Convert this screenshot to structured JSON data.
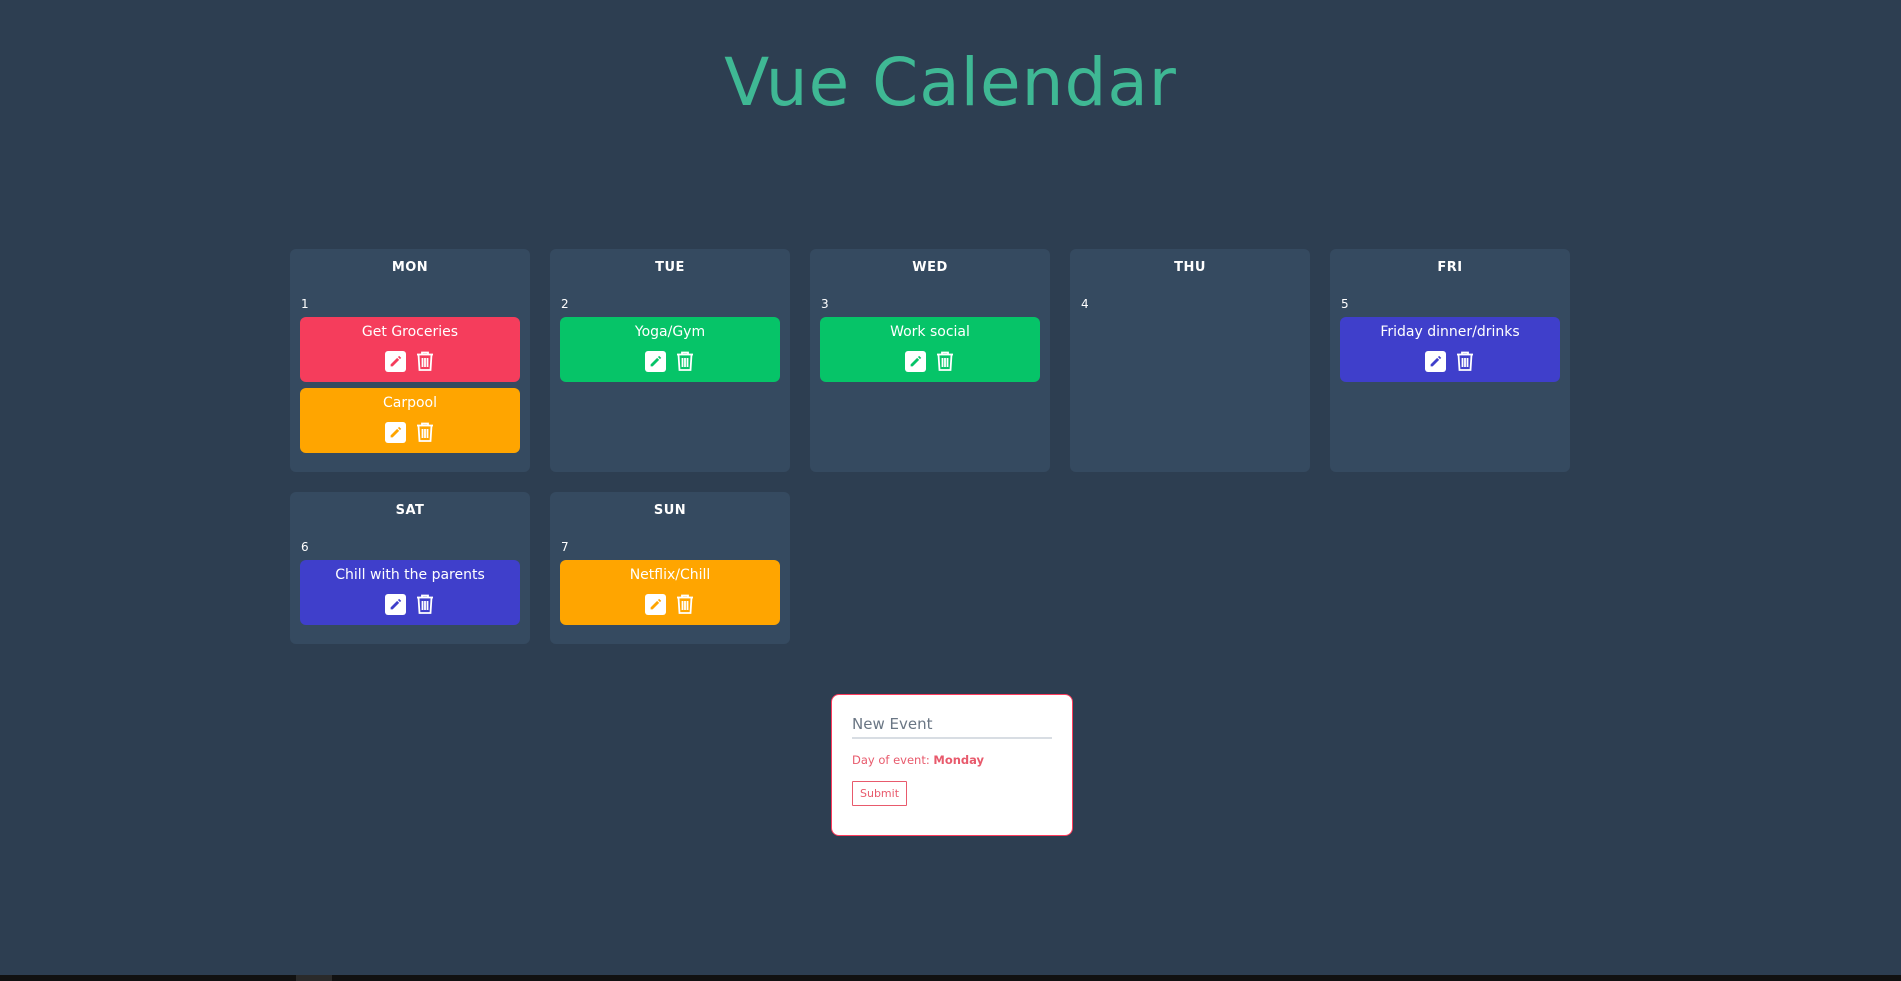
{
  "app": {
    "title": "Vue Calendar"
  },
  "colors": {
    "background": "#2d3e51",
    "card": "#354a60",
    "title": "#3fb894",
    "red": "#f53d5c",
    "orange": "#ffa500",
    "green": "#06c468",
    "blue": "#3f3fcb",
    "formAccent": "#e85a6c"
  },
  "days": [
    {
      "name": "MON",
      "number": "1",
      "events": [
        {
          "title": "Get Groceries",
          "color": "#f53d5c"
        },
        {
          "title": "Carpool",
          "color": "#ffa500"
        }
      ]
    },
    {
      "name": "TUE",
      "number": "2",
      "events": [
        {
          "title": "Yoga/Gym",
          "color": "#06c468"
        }
      ]
    },
    {
      "name": "WED",
      "number": "3",
      "events": [
        {
          "title": "Work social",
          "color": "#06c468"
        }
      ]
    },
    {
      "name": "THU",
      "number": "4",
      "events": []
    },
    {
      "name": "FRI",
      "number": "5",
      "events": [
        {
          "title": "Friday dinner/drinks",
          "color": "#3f3fcb"
        }
      ]
    },
    {
      "name": "SAT",
      "number": "6",
      "events": [
        {
          "title": "Chill with the parents",
          "color": "#3f3fcb"
        }
      ]
    },
    {
      "name": "SUN",
      "number": "7",
      "events": [
        {
          "title": "Netflix/Chill",
          "color": "#ffa500"
        }
      ]
    }
  ],
  "form": {
    "placeholder": "New Event",
    "value": "",
    "day_label": "Day of event:",
    "day_value": "Monday",
    "submit_label": "Submit"
  },
  "icons": {
    "edit": "pencil-icon",
    "delete": "trash-icon"
  }
}
